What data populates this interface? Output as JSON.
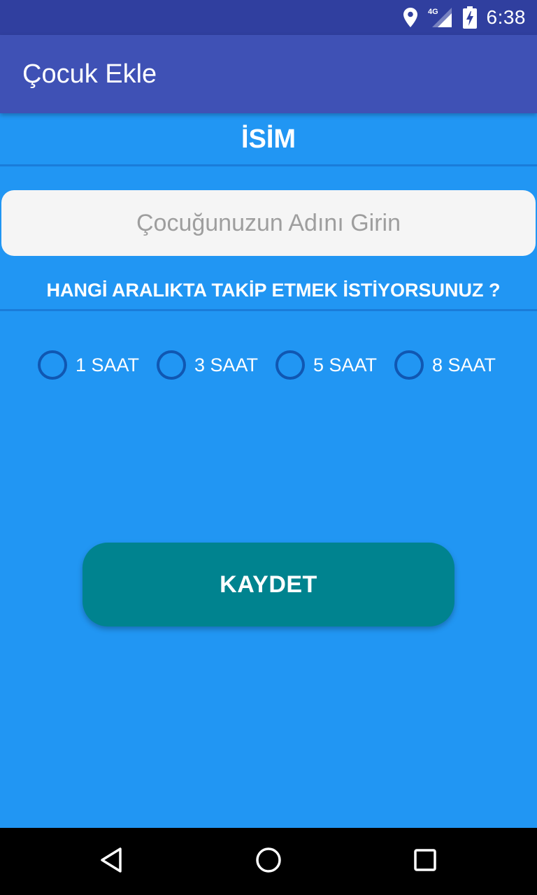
{
  "status_bar": {
    "time": "6:38",
    "network": "4G",
    "icons": [
      "location-icon",
      "signal-icon",
      "battery-charging-icon"
    ]
  },
  "app_bar": {
    "title": "Çocuk Ekle"
  },
  "form": {
    "name_heading": "İSİM",
    "name_input": {
      "value": "",
      "placeholder": "Çocuğunuzun Adını Girin"
    },
    "interval_question": "HANGİ ARALIKTA TAKİP ETMEK İSTİYORSUNUZ ?",
    "interval_options": [
      {
        "label": "1 SAAT",
        "selected": false
      },
      {
        "label": "3 SAAT",
        "selected": false
      },
      {
        "label": "5 SAAT",
        "selected": false
      },
      {
        "label": "8 SAAT",
        "selected": false
      }
    ],
    "save_label": "KAYDET"
  },
  "nav_bar": {
    "buttons": [
      "back-icon",
      "home-icon",
      "recents-icon"
    ]
  },
  "colors": {
    "status_bar": "#303F9F",
    "app_bar": "#3F51B5",
    "background": "#2196F3",
    "input_bg": "#F5F5F5",
    "save_button": "#00838F"
  }
}
